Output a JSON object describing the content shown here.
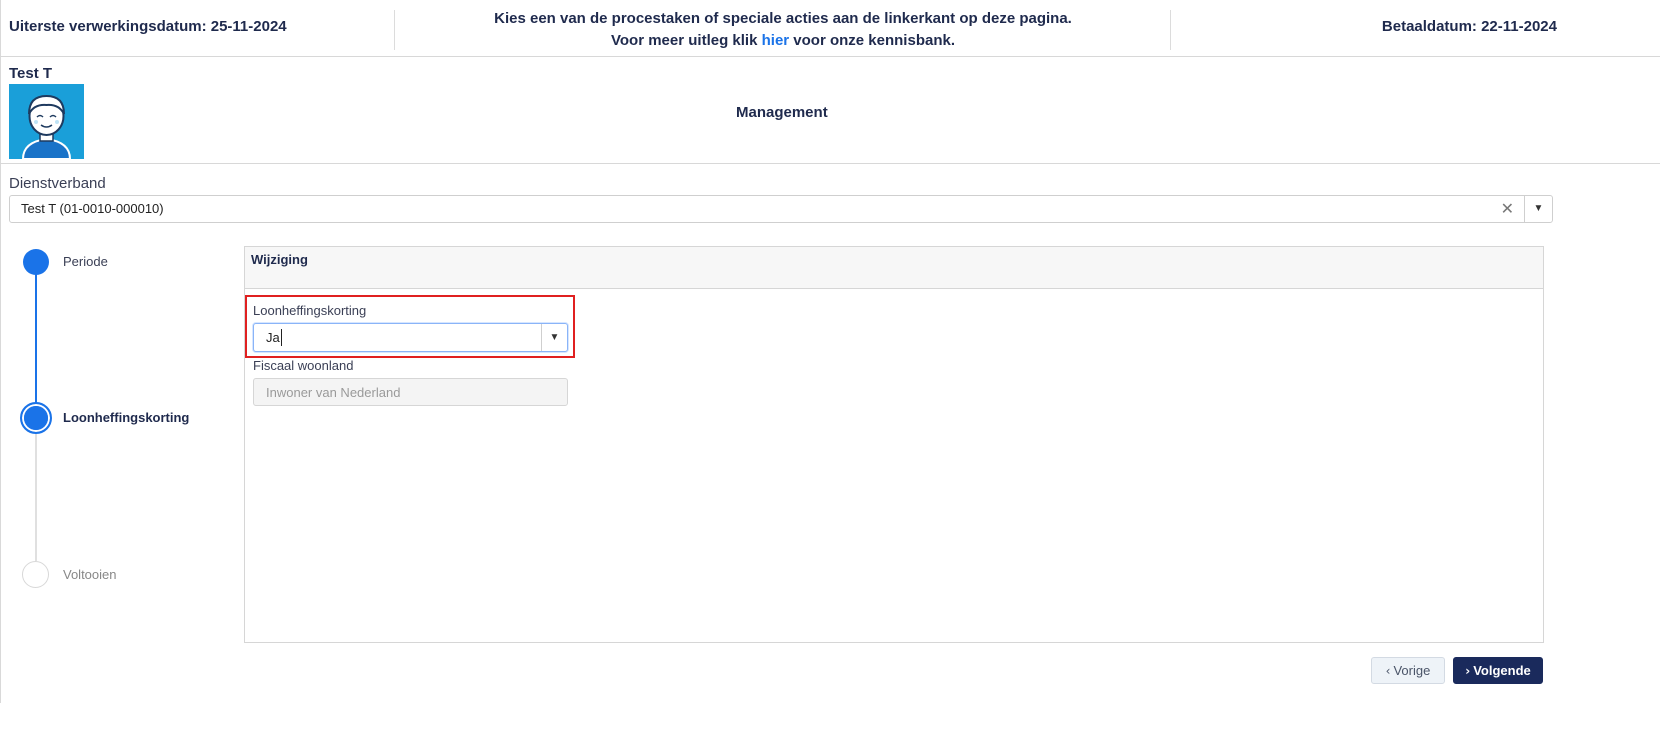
{
  "header": {
    "processing_date_label": "Uiterste verwerkingsdatum: 25-11-2024",
    "instruction_line1": "Kies een van de procestaken of speciale acties aan de linkerkant op deze pagina.",
    "instruction_line2_pre": "Voor meer uitleg klik ",
    "instruction_link": "hier",
    "instruction_line2_post": " voor onze kennisbank.",
    "payment_date_label": "Betaaldatum: 22-11-2024"
  },
  "employee": {
    "name": "Test T",
    "department": "Management",
    "avatar_icon": "person-avatar-icon"
  },
  "dienstverband": {
    "label": "Dienstverband",
    "value": "Test T (01-0010-000010)",
    "clear_icon": "✕",
    "arrow_icon": "▼"
  },
  "stepper": {
    "steps": [
      {
        "label": "Periode",
        "state": "done"
      },
      {
        "label": "Loonheffingskorting",
        "state": "active"
      },
      {
        "label": "Voltooien",
        "state": "todo"
      }
    ],
    "active_color": "#1a73e8"
  },
  "panel": {
    "title": "Wijziging",
    "fields": {
      "loonheffingskorting": {
        "label": "Loonheffingskorting",
        "value": "Ja",
        "arrow_icon": "▼"
      },
      "fiscaal_woonland": {
        "label": "Fiscaal woonland",
        "value": "Inwoner van Nederland"
      }
    }
  },
  "buttons": {
    "prev_label": "Vorige",
    "prev_icon": "‹",
    "next_label": "Volgende",
    "next_icon": "›"
  },
  "colors": {
    "highlight_border": "#e02020",
    "primary_button": "#1a2a5c",
    "link": "#1a73e8"
  }
}
